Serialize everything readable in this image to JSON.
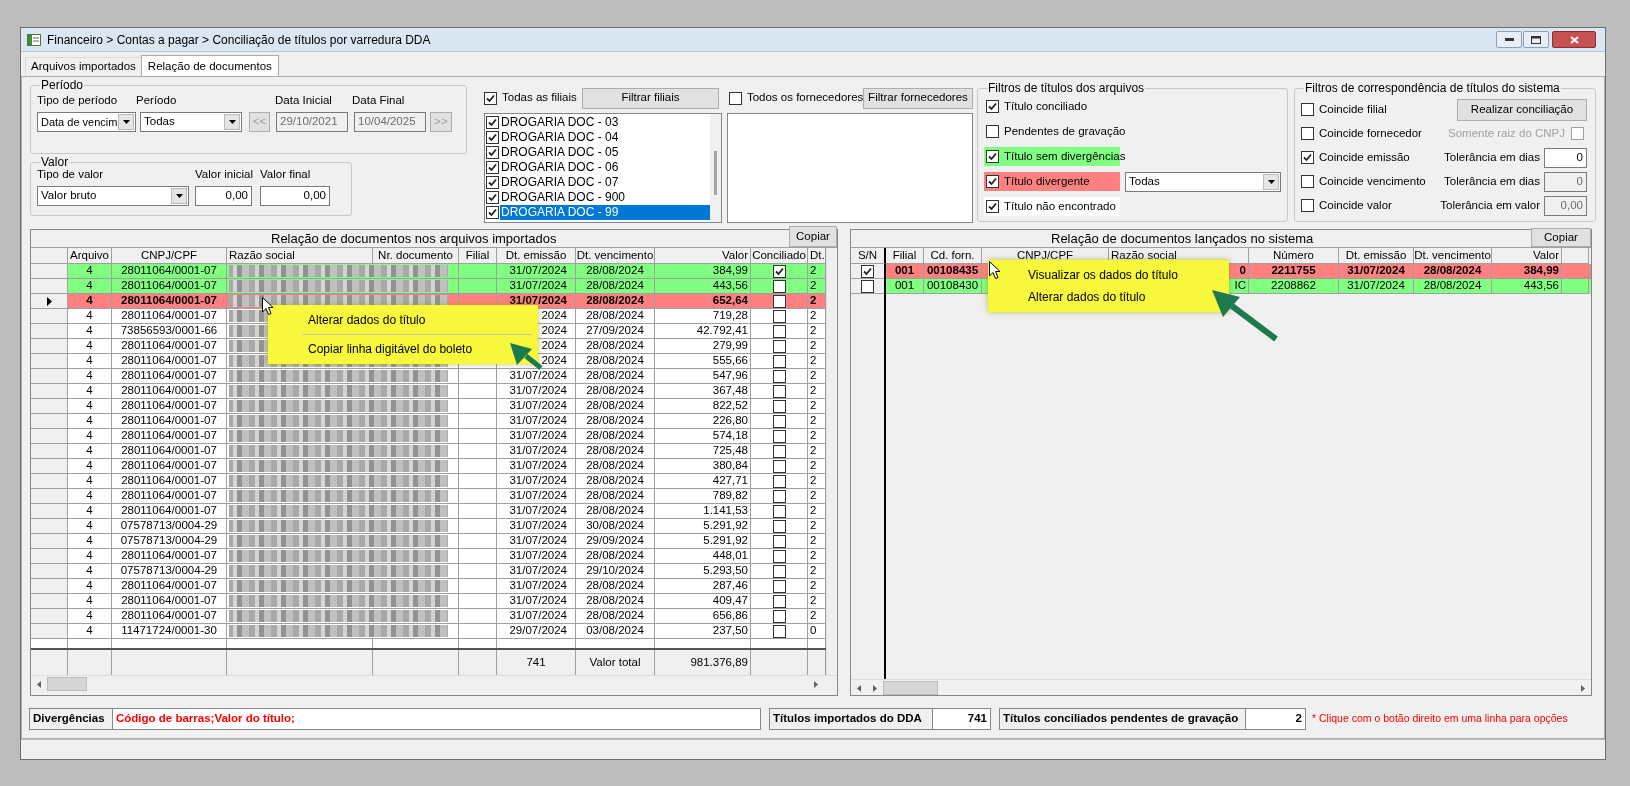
{
  "window": {
    "title": "Financeiro > Contas a pagar > Conciliação de títulos por varredura DDA"
  },
  "tabs": [
    {
      "label": "Arquivos importados",
      "selected": false
    },
    {
      "label": "Relação de documentos",
      "selected": true
    }
  ],
  "periodo": {
    "legend": "Período",
    "tipo_label": "Tipo de período",
    "tipo_value": "Data de vencim",
    "periodo_label": "Período",
    "periodo_value": "Todas",
    "data_inicial_label": "Data Inicial",
    "data_inicial": "29/10/2021",
    "data_final_label": "Data Final",
    "data_final": "10/04/2025",
    "prev": "<<",
    "next": ">>"
  },
  "valor": {
    "legend": "Valor",
    "tipo_label": "Tipo de valor",
    "tipo_value": "Valor bruto",
    "inicial_label": "Valor inicial",
    "inicial": "0,00",
    "final_label": "Valor final",
    "final": "0,00"
  },
  "filiais": {
    "all_label": "Todas as filiais",
    "all_checked": true,
    "button": "Filtrar filiais",
    "items": [
      {
        "label": "DROGARIA DOC - 03",
        "checked": true,
        "selected": false
      },
      {
        "label": "DROGARIA DOC - 04",
        "checked": true,
        "selected": false
      },
      {
        "label": "DROGARIA DOC - 05",
        "checked": true,
        "selected": false
      },
      {
        "label": "DROGARIA DOC - 06",
        "checked": true,
        "selected": false
      },
      {
        "label": "DROGARIA DOC - 07",
        "checked": true,
        "selected": false
      },
      {
        "label": "DROGARIA DOC - 900",
        "checked": true,
        "selected": false
      },
      {
        "label": "DROGARIA DOC - 99",
        "checked": true,
        "selected": true
      }
    ]
  },
  "fornecedores": {
    "all_label": "Todos os fornecedores",
    "all_checked": false,
    "button": "Filtrar fornecedores"
  },
  "filtros_arquivos": {
    "legend": "Filtros de títulos dos arquivos",
    "divergente_select": "Todas",
    "items": [
      {
        "label": "Título conciliado",
        "checked": true
      },
      {
        "label": "Pendentes de gravação",
        "checked": false
      },
      {
        "label": "Título sem divergências",
        "checked": true,
        "color": "#80ff80"
      },
      {
        "label": "Título divergente",
        "checked": true,
        "color": "#ff8080"
      },
      {
        "label": "Título não encontrado",
        "checked": true,
        "color": "#ffffff"
      }
    ]
  },
  "filtros_sistema": {
    "legend": "Filtros de correspondência de títulos do sistema",
    "button": "Realizar conciliação",
    "raiz": {
      "label": "Somente raiz do CNPJ",
      "checked": false,
      "disabled": true
    },
    "items": [
      {
        "label": "Coincide filial",
        "checked": false
      },
      {
        "label": "Coincide fornecedor",
        "checked": false
      },
      {
        "label": "Coincide emissão",
        "checked": true,
        "tolerance_label": "Tolerância em dias",
        "tolerance": "0",
        "disabled": false
      },
      {
        "label": "Coincide vencimento",
        "checked": false,
        "tolerance_label": "Tolerância em dias",
        "tolerance": "0",
        "disabled": true
      },
      {
        "label": "Coincide valor",
        "checked": false,
        "tolerance_label": "Tolerância em valor",
        "tolerance": "0,00",
        "disabled": true
      }
    ]
  },
  "imported_table": {
    "title": "Relação de documentos nos arquivos importados",
    "copy_button": "Copiar",
    "columns": [
      "Arquivo",
      "CNPJ/CPF",
      "Razão social",
      "Nr. documento",
      "Filial",
      "Dt. emissão",
      "Dt. vencimento",
      "Valor",
      "Conciliado",
      "Dt."
    ],
    "rows": [
      {
        "arquivo": "4",
        "cnpj": "28011064/0001-07",
        "emissao": "31/07/2024",
        "vencimento": "28/08/2024",
        "valor": "384,99",
        "conciliado": true,
        "column_11": "2",
        "color": "#80ff80",
        "selected": false
      },
      {
        "arquivo": "4",
        "cnpj": "28011064/0001-07",
        "emissao": "31/07/2024",
        "vencimento": "28/08/2024",
        "valor": "443,56",
        "conciliado": false,
        "column_11": "2",
        "color": "#80ff80",
        "selected": false
      },
      {
        "arquivo": "4",
        "cnpj": "28011064/0001-07",
        "emissao": "31/07/2024",
        "vencimento": "28/08/2024",
        "valor": "652,64",
        "conciliado": false,
        "column_11": "2",
        "color": "#ff8080",
        "selected": true
      },
      {
        "arquivo": "4",
        "cnpj": "28011064/0001-07",
        "emissao": "2024",
        "vencimento": "28/08/2024",
        "valor": "719,28",
        "conciliado": false,
        "column_11": "2",
        "color": "#ffffff",
        "selected": false
      },
      {
        "arquivo": "4",
        "cnpj": "73856593/0001-66",
        "emissao": "2024",
        "vencimento": "27/09/2024",
        "valor": "42.792,41",
        "conciliado": false,
        "column_11": "2",
        "color": "#ffffff",
        "selected": false
      },
      {
        "arquivo": "4",
        "cnpj": "28011064/0001-07",
        "emissao": "2024",
        "vencimento": "28/08/2024",
        "valor": "279,99",
        "conciliado": false,
        "column_11": "2",
        "color": "#ffffff",
        "selected": false
      },
      {
        "arquivo": "4",
        "cnpj": "28011064/0001-07",
        "emissao": "2024",
        "vencimento": "28/08/2024",
        "valor": "555,66",
        "conciliado": false,
        "column_11": "2",
        "color": "#ffffff",
        "selected": false
      },
      {
        "arquivo": "4",
        "cnpj": "28011064/0001-07",
        "emissao": "31/07/2024",
        "vencimento": "28/08/2024",
        "valor": "547,96",
        "conciliado": false,
        "column_11": "2",
        "color": "#ffffff",
        "selected": false
      },
      {
        "arquivo": "4",
        "cnpj": "28011064/0001-07",
        "emissao": "31/07/2024",
        "vencimento": "28/08/2024",
        "valor": "367,48",
        "conciliado": false,
        "column_11": "2",
        "color": "#ffffff",
        "selected": false
      },
      {
        "arquivo": "4",
        "cnpj": "28011064/0001-07",
        "emissao": "31/07/2024",
        "vencimento": "28/08/2024",
        "valor": "822,52",
        "conciliado": false,
        "column_11": "2",
        "color": "#ffffff",
        "selected": false
      },
      {
        "arquivo": "4",
        "cnpj": "28011064/0001-07",
        "emissao": "31/07/2024",
        "vencimento": "28/08/2024",
        "valor": "226,80",
        "conciliado": false,
        "column_11": "2",
        "color": "#ffffff",
        "selected": false
      },
      {
        "arquivo": "4",
        "cnpj": "28011064/0001-07",
        "emissao": "31/07/2024",
        "vencimento": "28/08/2024",
        "valor": "574,18",
        "conciliado": false,
        "column_11": "2",
        "color": "#ffffff",
        "selected": false
      },
      {
        "arquivo": "4",
        "cnpj": "28011064/0001-07",
        "emissao": "31/07/2024",
        "vencimento": "28/08/2024",
        "valor": "725,48",
        "conciliado": false,
        "column_11": "2",
        "color": "#ffffff",
        "selected": false
      },
      {
        "arquivo": "4",
        "cnpj": "28011064/0001-07",
        "emissao": "31/07/2024",
        "vencimento": "28/08/2024",
        "valor": "380,84",
        "conciliado": false,
        "column_11": "2",
        "color": "#ffffff",
        "selected": false
      },
      {
        "arquivo": "4",
        "cnpj": "28011064/0001-07",
        "emissao": "31/07/2024",
        "vencimento": "28/08/2024",
        "valor": "427,71",
        "conciliado": false,
        "column_11": "2",
        "color": "#ffffff",
        "selected": false
      },
      {
        "arquivo": "4",
        "cnpj": "28011064/0001-07",
        "emissao": "31/07/2024",
        "vencimento": "28/08/2024",
        "valor": "789,82",
        "conciliado": false,
        "column_11": "2",
        "color": "#ffffff",
        "selected": false
      },
      {
        "arquivo": "4",
        "cnpj": "28011064/0001-07",
        "emissao": "31/07/2024",
        "vencimento": "28/08/2024",
        "valor": "1.141,53",
        "conciliado": false,
        "column_11": "2",
        "color": "#ffffff",
        "selected": false
      },
      {
        "arquivo": "4",
        "cnpj": "07578713/0004-29",
        "emissao": "31/07/2024",
        "vencimento": "30/08/2024",
        "valor": "5.291,92",
        "conciliado": false,
        "column_11": "2",
        "color": "#ffffff",
        "selected": false
      },
      {
        "arquivo": "4",
        "cnpj": "07578713/0004-29",
        "emissao": "31/07/2024",
        "vencimento": "29/09/2024",
        "valor": "5.291,92",
        "conciliado": false,
        "column_11": "2",
        "color": "#ffffff",
        "selected": false
      },
      {
        "arquivo": "4",
        "cnpj": "28011064/0001-07",
        "emissao": "31/07/2024",
        "vencimento": "28/08/2024",
        "valor": "448,01",
        "conciliado": false,
        "column_11": "2",
        "color": "#ffffff",
        "selected": false
      },
      {
        "arquivo": "4",
        "cnpj": "07578713/0004-29",
        "emissao": "31/07/2024",
        "vencimento": "29/10/2024",
        "valor": "5.293,50",
        "conciliado": false,
        "column_11": "2",
        "color": "#ffffff",
        "selected": false
      },
      {
        "arquivo": "4",
        "cnpj": "28011064/0001-07",
        "emissao": "31/07/2024",
        "vencimento": "28/08/2024",
        "valor": "287,46",
        "conciliado": false,
        "column_11": "2",
        "color": "#ffffff",
        "selected": false
      },
      {
        "arquivo": "4",
        "cnpj": "28011064/0001-07",
        "emissao": "31/07/2024",
        "vencimento": "28/08/2024",
        "valor": "409,47",
        "conciliado": false,
        "column_11": "2",
        "color": "#ffffff",
        "selected": false
      },
      {
        "arquivo": "4",
        "cnpj": "28011064/0001-07",
        "emissao": "31/07/2024",
        "vencimento": "28/08/2024",
        "valor": "656,86",
        "conciliado": false,
        "column_11": "2",
        "color": "#ffffff",
        "selected": false
      },
      {
        "arquivo": "4",
        "cnpj": "11471724/0001-30",
        "emissao": "29/07/2024",
        "vencimento": "03/08/2024",
        "valor": "237,50",
        "conciliado": false,
        "column_11": "0",
        "color": "#ffffff",
        "selected": false
      }
    ],
    "footer": {
      "count": "741",
      "total_label": "Valor total",
      "total": "981.376,89"
    }
  },
  "system_table": {
    "title": "Relação de documentos lançados no sistema",
    "copy_button": "Copiar",
    "columns": [
      "S/N",
      "Filial",
      "Cd. forn.",
      "CNPJ/CPF",
      "Razão social",
      "Número",
      "Dt. emissão",
      "Dt. vencimento",
      "Valor"
    ],
    "rows": [
      {
        "checked": true,
        "filial": "001",
        "cd_forn": "00108435",
        "razao": "0",
        "numero": "2211755",
        "emissao": "31/07/2024",
        "vencimento": "28/08/2024",
        "valor": "384,99",
        "color": "#ff8080",
        "selected": true
      },
      {
        "checked": false,
        "filial": "001",
        "cd_forn": "00108430",
        "razao": "IC",
        "numero": "2208862",
        "emissao": "31/07/2024",
        "vencimento": "28/08/2024",
        "valor": "443,56",
        "color": "#80ff80",
        "selected": false
      }
    ]
  },
  "context_menus": [
    {
      "items": [
        {
          "kind": "item",
          "label": "Alterar dados do título"
        },
        {
          "kind": "separator"
        },
        {
          "kind": "item",
          "label": "Copiar linha digitável do boleto"
        }
      ]
    },
    {
      "items": [
        {
          "kind": "item",
          "label": "Visualizar os dados do título"
        },
        {
          "kind": "item",
          "label": "Alterar dados do título"
        }
      ]
    }
  ],
  "summary": {
    "divergencias_label": "Divergências",
    "divergencias": "Código de barras;Valor do título;",
    "importados_label": "Títulos importados do DDA",
    "importados": "741",
    "pendentes_label": "Títulos conciliados pendentes de gravação",
    "pendentes": "2",
    "note": "* Clique com o botão direito em uma linha para opções"
  }
}
